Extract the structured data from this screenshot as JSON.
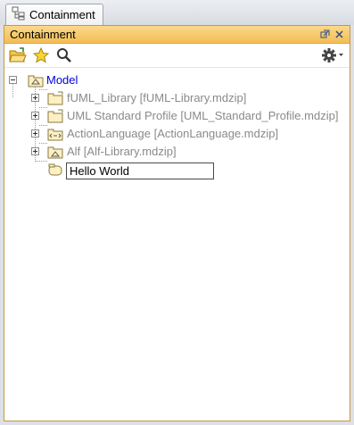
{
  "tab": {
    "label": "Containment",
    "icon": "containment-tree-icon"
  },
  "panel": {
    "title": "Containment",
    "header_buttons": [
      "restore-icon",
      "close-icon"
    ]
  },
  "toolbar": {
    "left_icons": [
      "open-folder-icon",
      "star-icon",
      "search-icon"
    ],
    "right_icons": [
      "gear-icon",
      "dropdown-arrow-icon"
    ]
  },
  "tree": {
    "root": {
      "label": "Model",
      "expanded": true,
      "icon": "model-package-icon"
    },
    "children": [
      {
        "label": "fUML_Library [fUML-Library.mdzip]",
        "icon": "package-icon",
        "expandable": true
      },
      {
        "label": "UML Standard Profile [UML_Standard_Profile.mdzip]",
        "icon": "package-icon",
        "expandable": true
      },
      {
        "label": "ActionLanguage [ActionLanguage.mdzip]",
        "icon": "profile-package-icon",
        "expandable": true
      },
      {
        "label": "Alf [Alf-Library.mdzip]",
        "icon": "model-package-icon",
        "expandable": true
      }
    ],
    "editing_item": {
      "value": "Hello World",
      "icon": "element-icon"
    }
  },
  "colors": {
    "header_gradient_top": "#fbd98a",
    "header_gradient_bottom": "#f3bd55",
    "root_label": "#0000e0",
    "library_label": "#8a8a8a"
  }
}
